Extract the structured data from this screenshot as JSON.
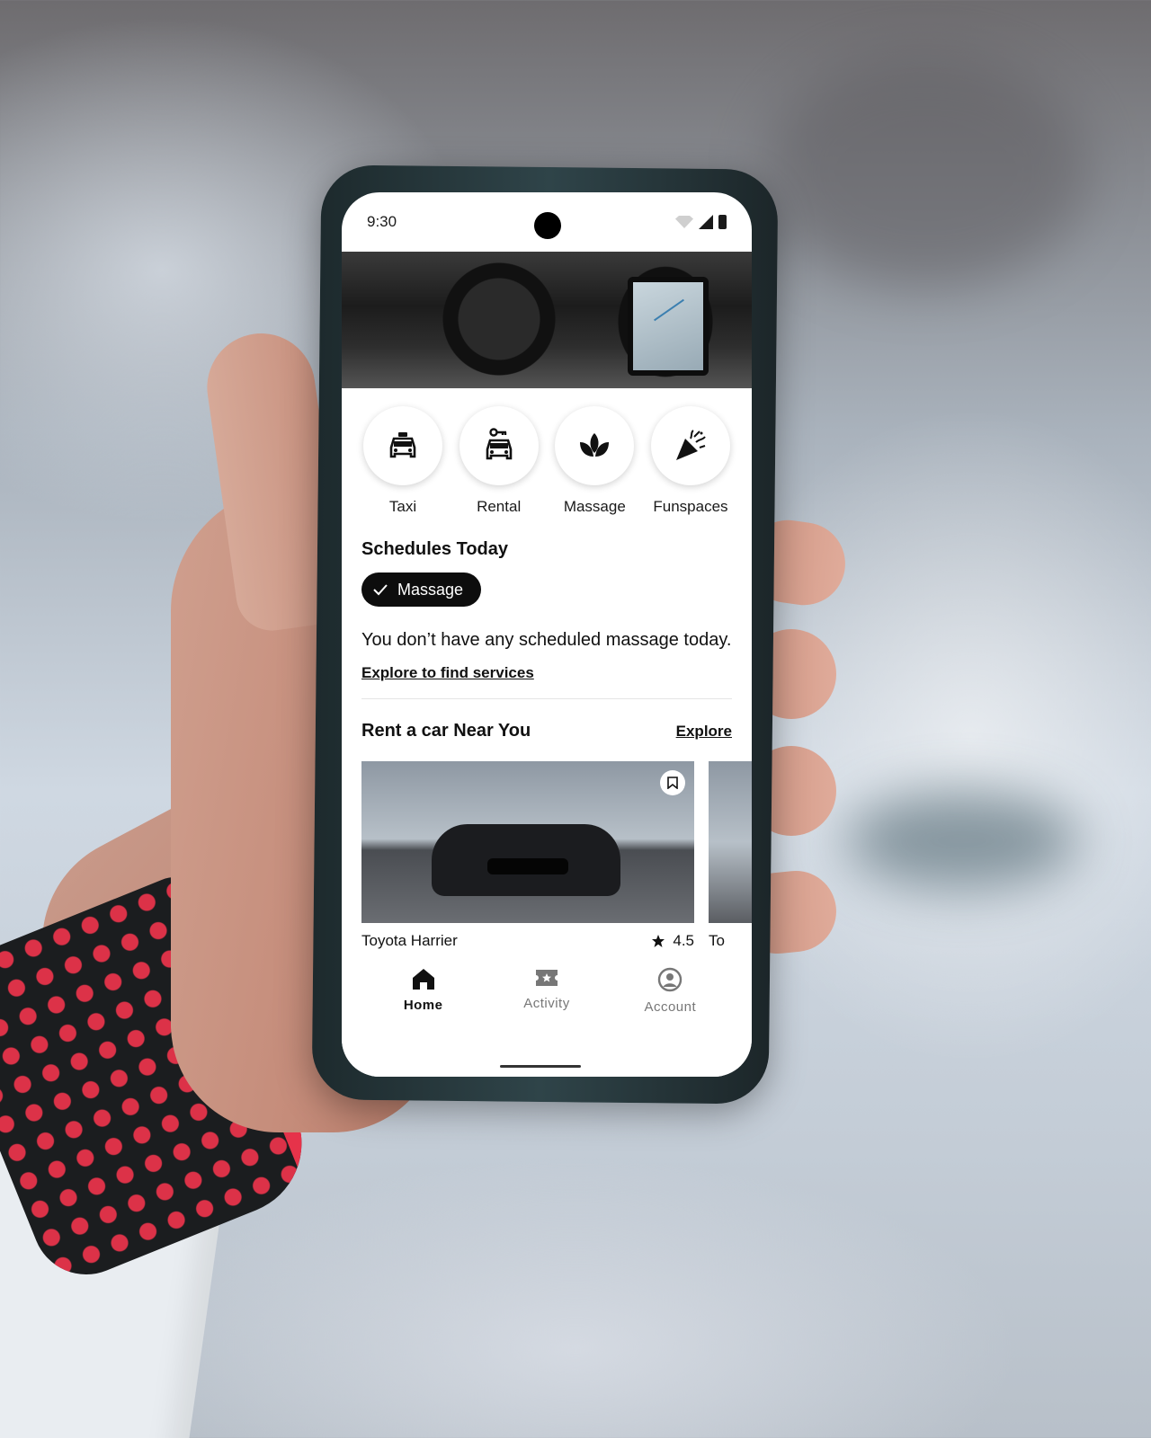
{
  "status_bar": {
    "time": "9:30"
  },
  "services": [
    {
      "label": "Taxi",
      "icon": "taxi-icon"
    },
    {
      "label": "Rental",
      "icon": "rental-car-icon"
    },
    {
      "label": "Massage",
      "icon": "lotus-icon"
    },
    {
      "label": "Funspaces",
      "icon": "party-popper-icon"
    }
  ],
  "schedules": {
    "title": "Schedules Today",
    "chip_label": "Massage",
    "empty_message": "You don’t have any scheduled massage today.",
    "explore_link": "Explore to find services"
  },
  "rent": {
    "title": "Rent a car Near You",
    "explore_label": "Explore",
    "cars": [
      {
        "name": "Toyota Harrier",
        "rating": "4.5"
      },
      {
        "name": "To"
      }
    ]
  },
  "nav": {
    "items": [
      {
        "label": "Home",
        "icon": "home-icon",
        "active": true
      },
      {
        "label": "Activity",
        "icon": "ticket-icon",
        "active": false
      },
      {
        "label": "Account",
        "icon": "account-icon",
        "active": false
      }
    ]
  },
  "colors": {
    "accent": "#0d0d0d",
    "background": "#ffffff"
  }
}
